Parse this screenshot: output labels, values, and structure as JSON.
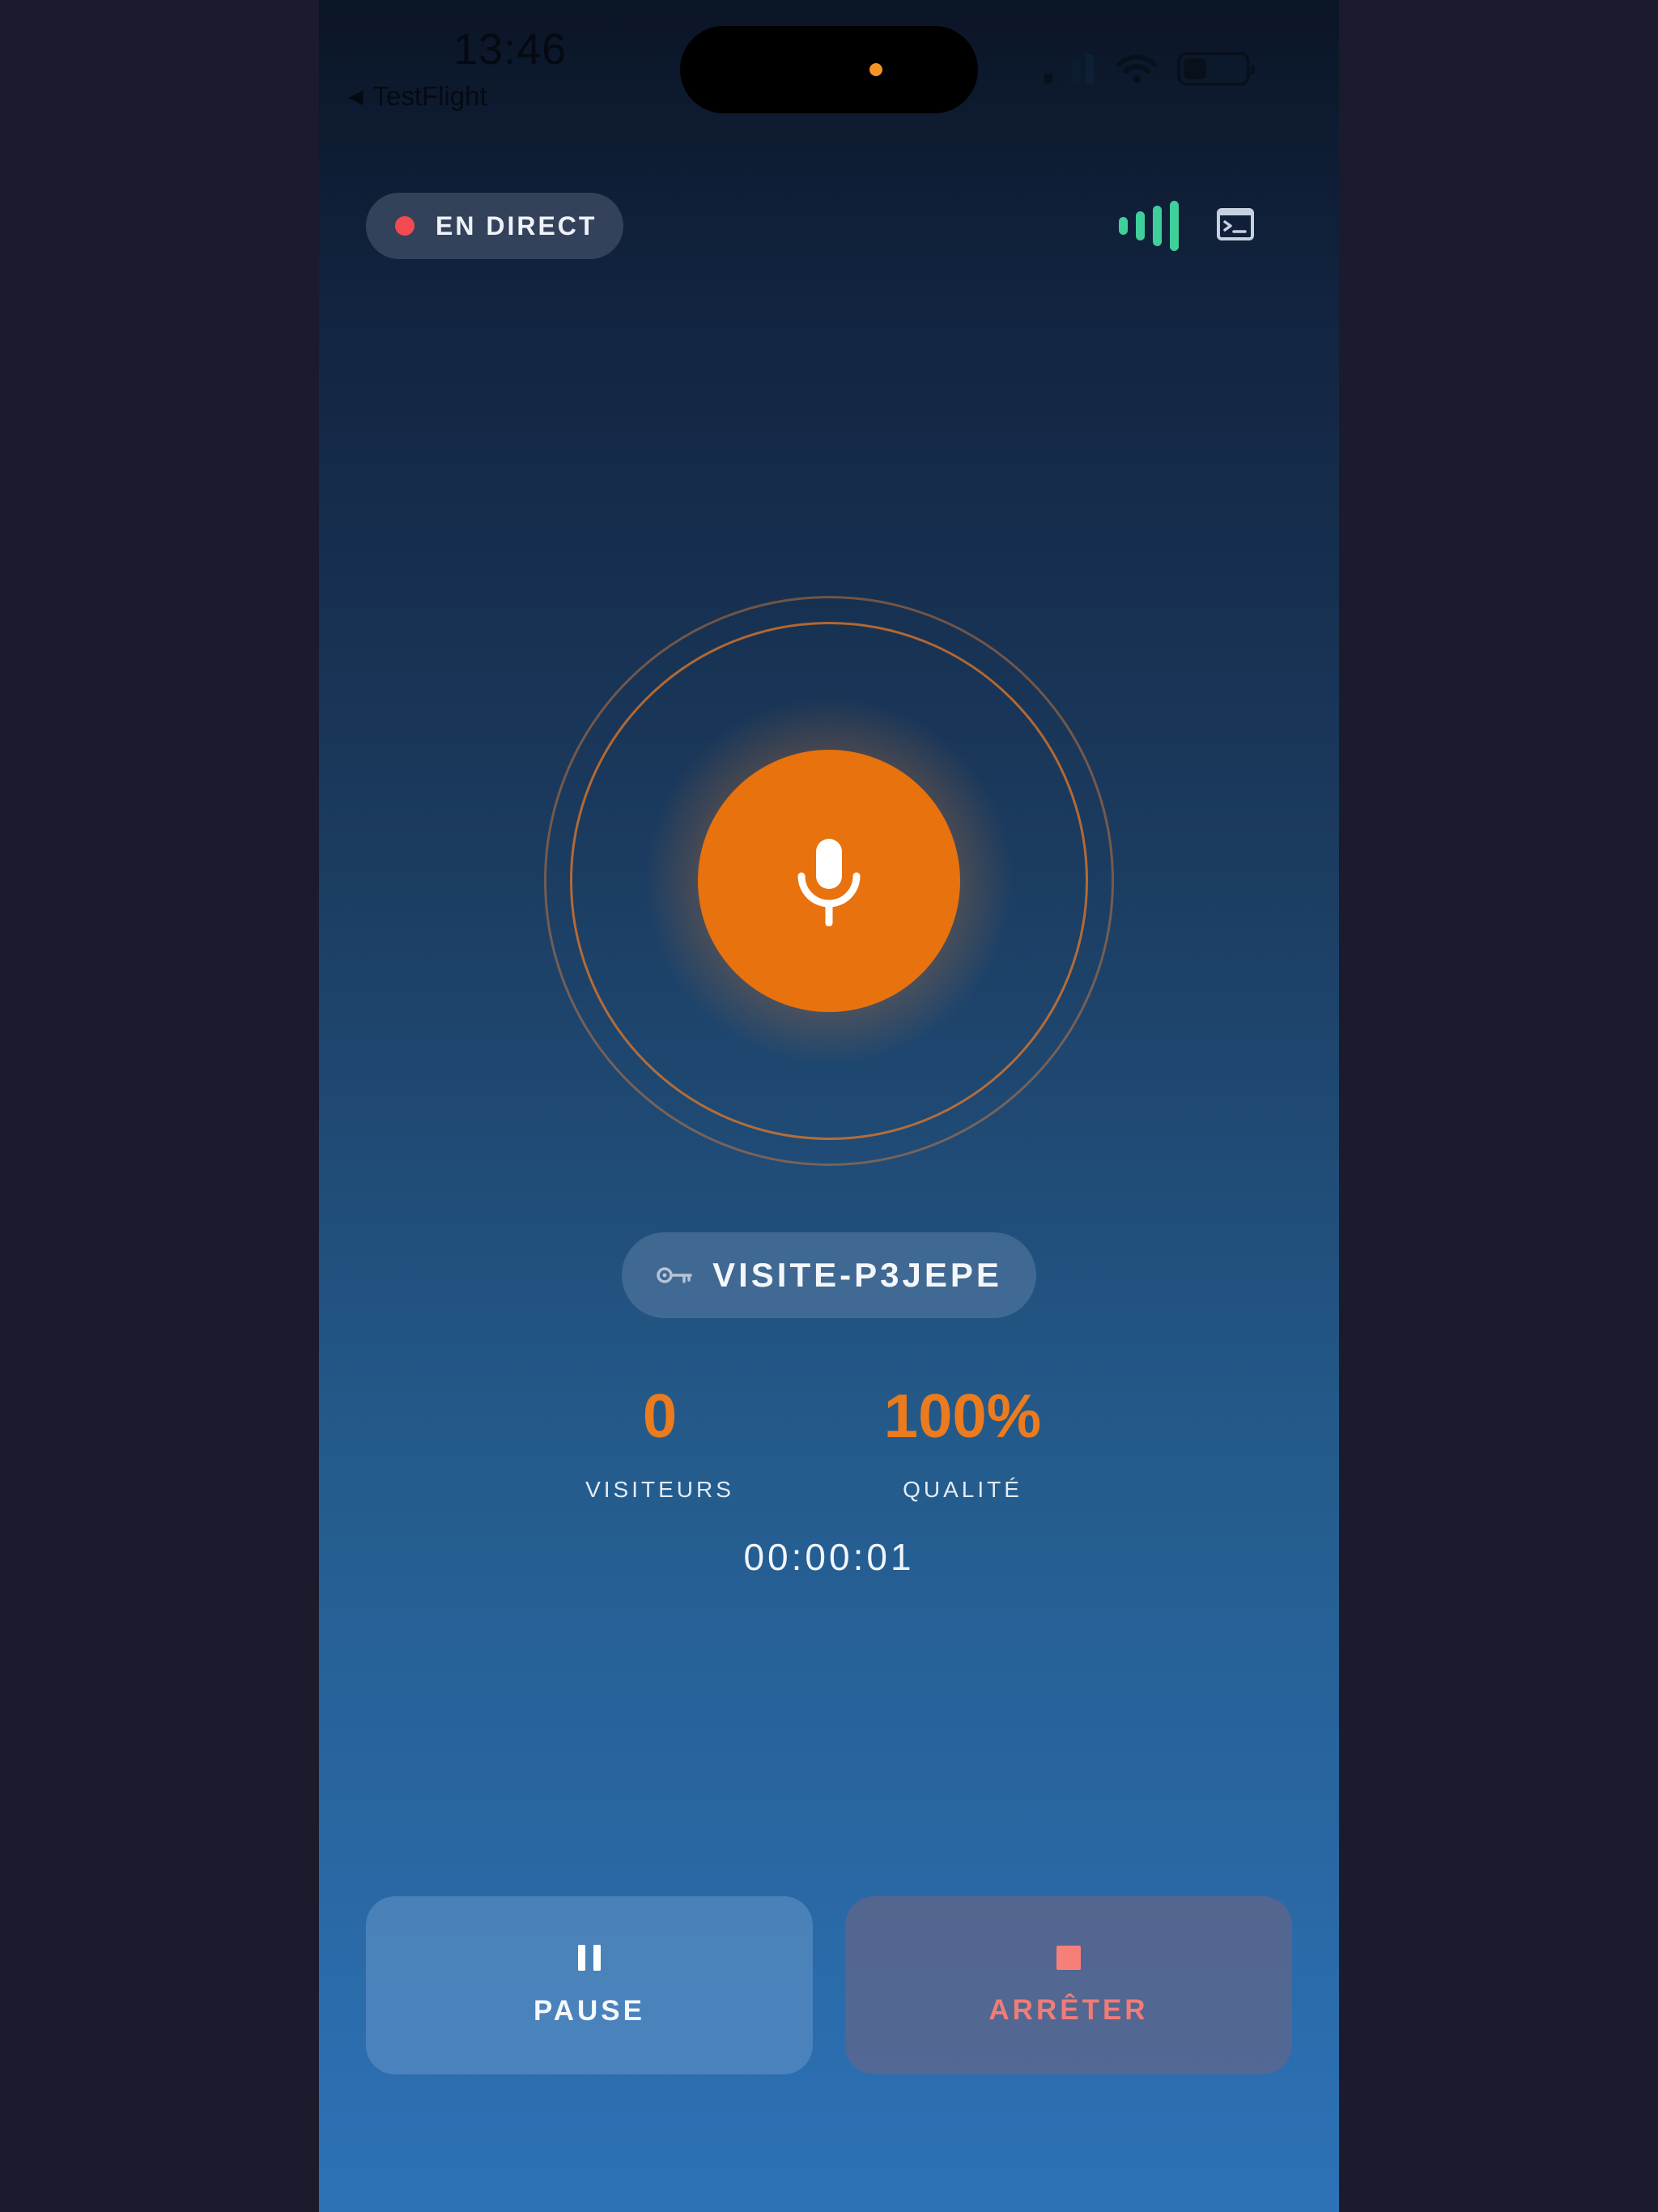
{
  "status_bar": {
    "time": "13:46",
    "back_app": "TestFlight",
    "icons": [
      "cellular-signal-icon",
      "wifi-icon",
      "battery-icon"
    ]
  },
  "header": {
    "live_label": "EN DIRECT",
    "icons": [
      "audio-level-icon",
      "terminal-icon"
    ]
  },
  "broadcast": {
    "mic_icon": "microphone-icon",
    "session_code": "VISITE-P3JEPE",
    "key_icon": "key-icon"
  },
  "stats": {
    "visitors_value": "0",
    "visitors_label": "VISITEURS",
    "quality_value": "100%",
    "quality_label": "QUALITÉ",
    "elapsed": "00:00:01"
  },
  "actions": {
    "pause_label": "PAUSE",
    "stop_label": "ARRÊTER"
  },
  "colors": {
    "accent": "#e8720e",
    "live_dot": "#f34a52",
    "level_green": "#3ecf9a",
    "stop_text": "#f07c78"
  }
}
